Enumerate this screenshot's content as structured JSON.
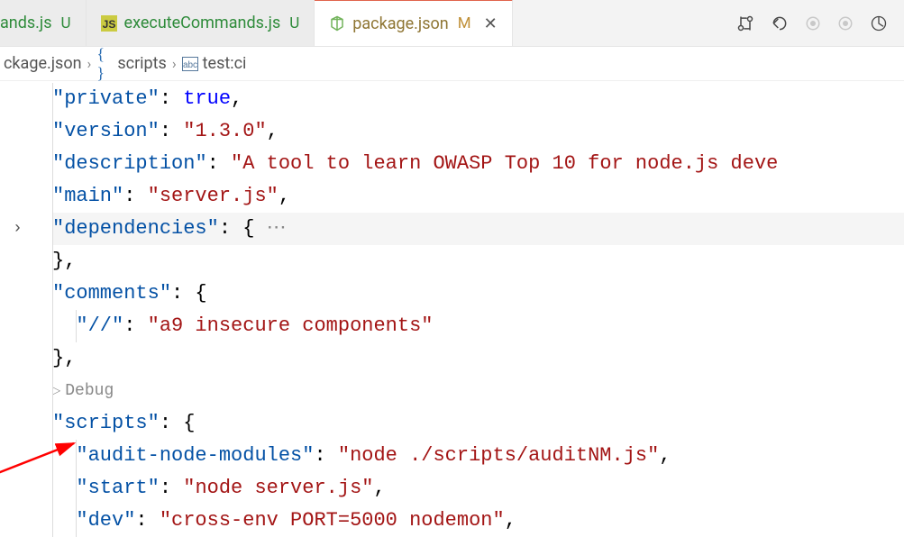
{
  "tabs": [
    {
      "name": "ands.js",
      "status": "U",
      "icon": "js"
    },
    {
      "name": "executeCommands.js",
      "status": "U",
      "icon": "js"
    },
    {
      "name": "package.json",
      "status": "M",
      "icon": "npm",
      "active": true
    }
  ],
  "breadcrumb": {
    "file": "ckage.json",
    "obj": "scripts",
    "leaf": "test:ci"
  },
  "code": {
    "private_key": "private",
    "private_val": "true",
    "version_key": "version",
    "version_val": "1.3.0",
    "description_key": "description",
    "description_val": "A tool to learn OWASP Top 10 for node.js deve",
    "main_key": "main",
    "main_val": "server.js",
    "dependencies_key": "dependencies",
    "comments_key": "comments",
    "comments_inner_key": "//",
    "comments_inner_val": "a9 insecure components",
    "debug_lens": "Debug",
    "scripts_key": "scripts",
    "audit_key": "audit-node-modules",
    "audit_val": "node ./scripts/auditNM.js",
    "start_key": "start",
    "start_val": "node server.js",
    "dev_key": "dev",
    "dev_val": "cross-env PORT=5000 nodemon"
  }
}
